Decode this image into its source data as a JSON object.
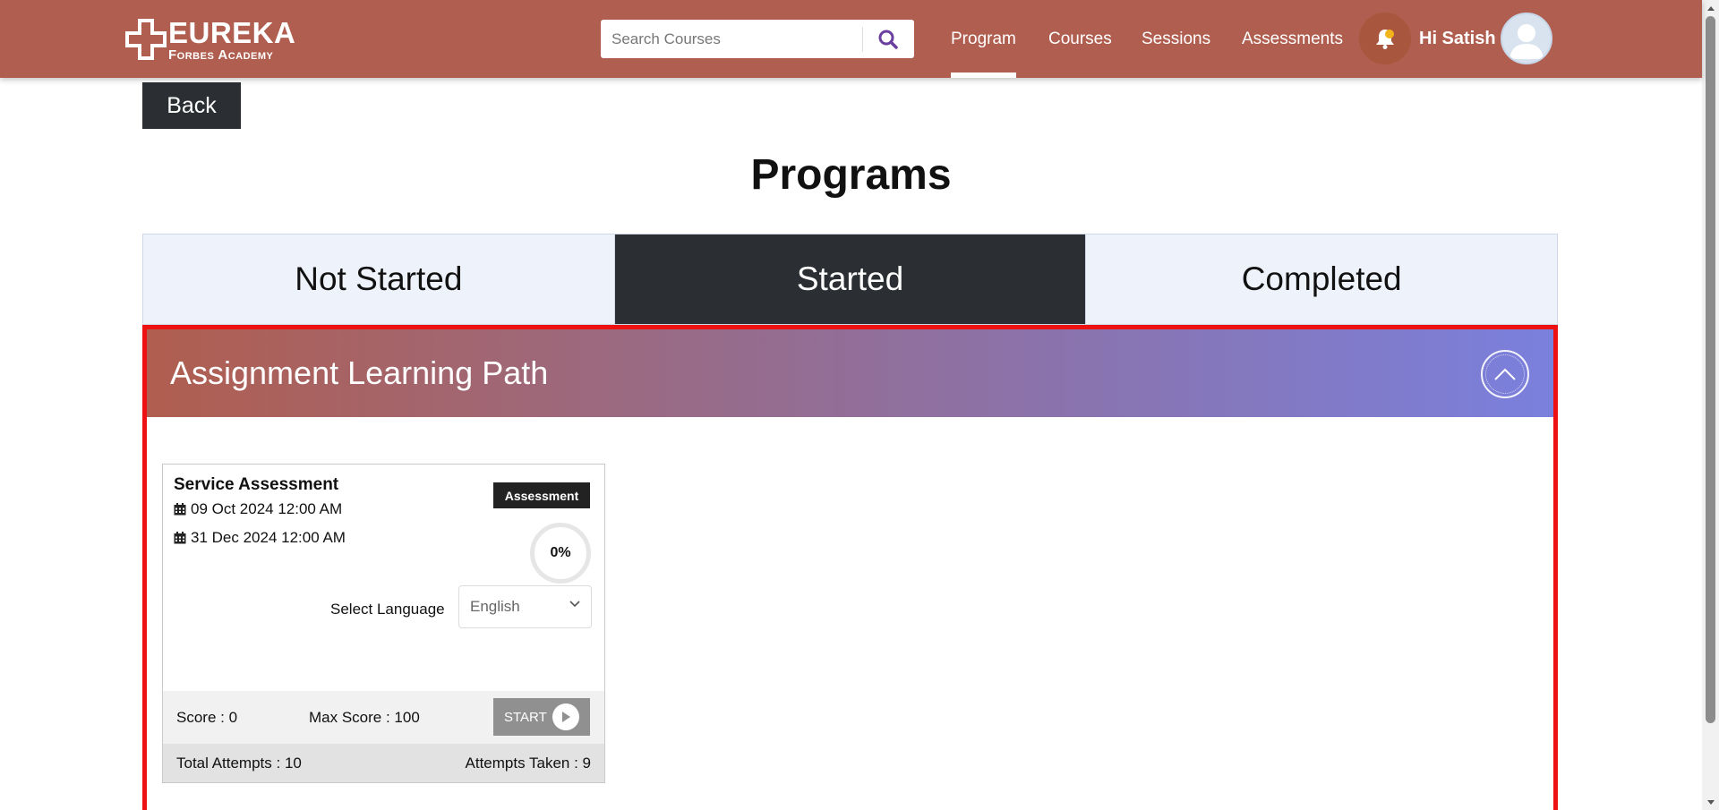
{
  "header": {
    "logo": {
      "line1": "EUREKA",
      "line2": "Forbes Academy"
    },
    "search": {
      "placeholder": "Search Courses",
      "value": ""
    },
    "nav": [
      {
        "label": "Program",
        "active": true
      },
      {
        "label": "Courses",
        "active": false
      },
      {
        "label": "Sessions",
        "active": false
      },
      {
        "label": "Assessments",
        "active": false
      }
    ],
    "greeting": "Hi Satish",
    "icons": {
      "search": "search-icon",
      "notifications": "bell-icon",
      "profile": "user-avatar-icon"
    }
  },
  "back_label": "Back",
  "page_title": "Programs",
  "tabs": [
    {
      "label": "Not Started",
      "active": false
    },
    {
      "label": "Started",
      "active": true
    },
    {
      "label": "Completed",
      "active": false
    }
  ],
  "learning_path": {
    "title": "Assignment Learning Path",
    "expanded": true,
    "cards": [
      {
        "title": "Service Assessment",
        "type_badge": "Assessment",
        "start_date": "09 Oct 2024 12:00 AM",
        "end_date": "31 Dec 2024 12:00 AM",
        "progress_label": "0%",
        "progress": 0,
        "language_label": "Select Language",
        "language_value": "English",
        "score": "Score : 0",
        "max_score": "Max Score : 100",
        "start_label": "START",
        "total_attempts": "Total Attempts : 10",
        "attempts_taken": "Attempts Taken : 9"
      }
    ]
  },
  "colors": {
    "header_bg": "#b05e4f",
    "dark": "#2b2f33",
    "tab_bg": "#eef3fb",
    "highlight_border": "#ee1111",
    "gradient_start": "#b05e4f",
    "gradient_end": "#7a80dd",
    "search_icon": "#6b3fa0",
    "bell": "#f3b41b"
  }
}
